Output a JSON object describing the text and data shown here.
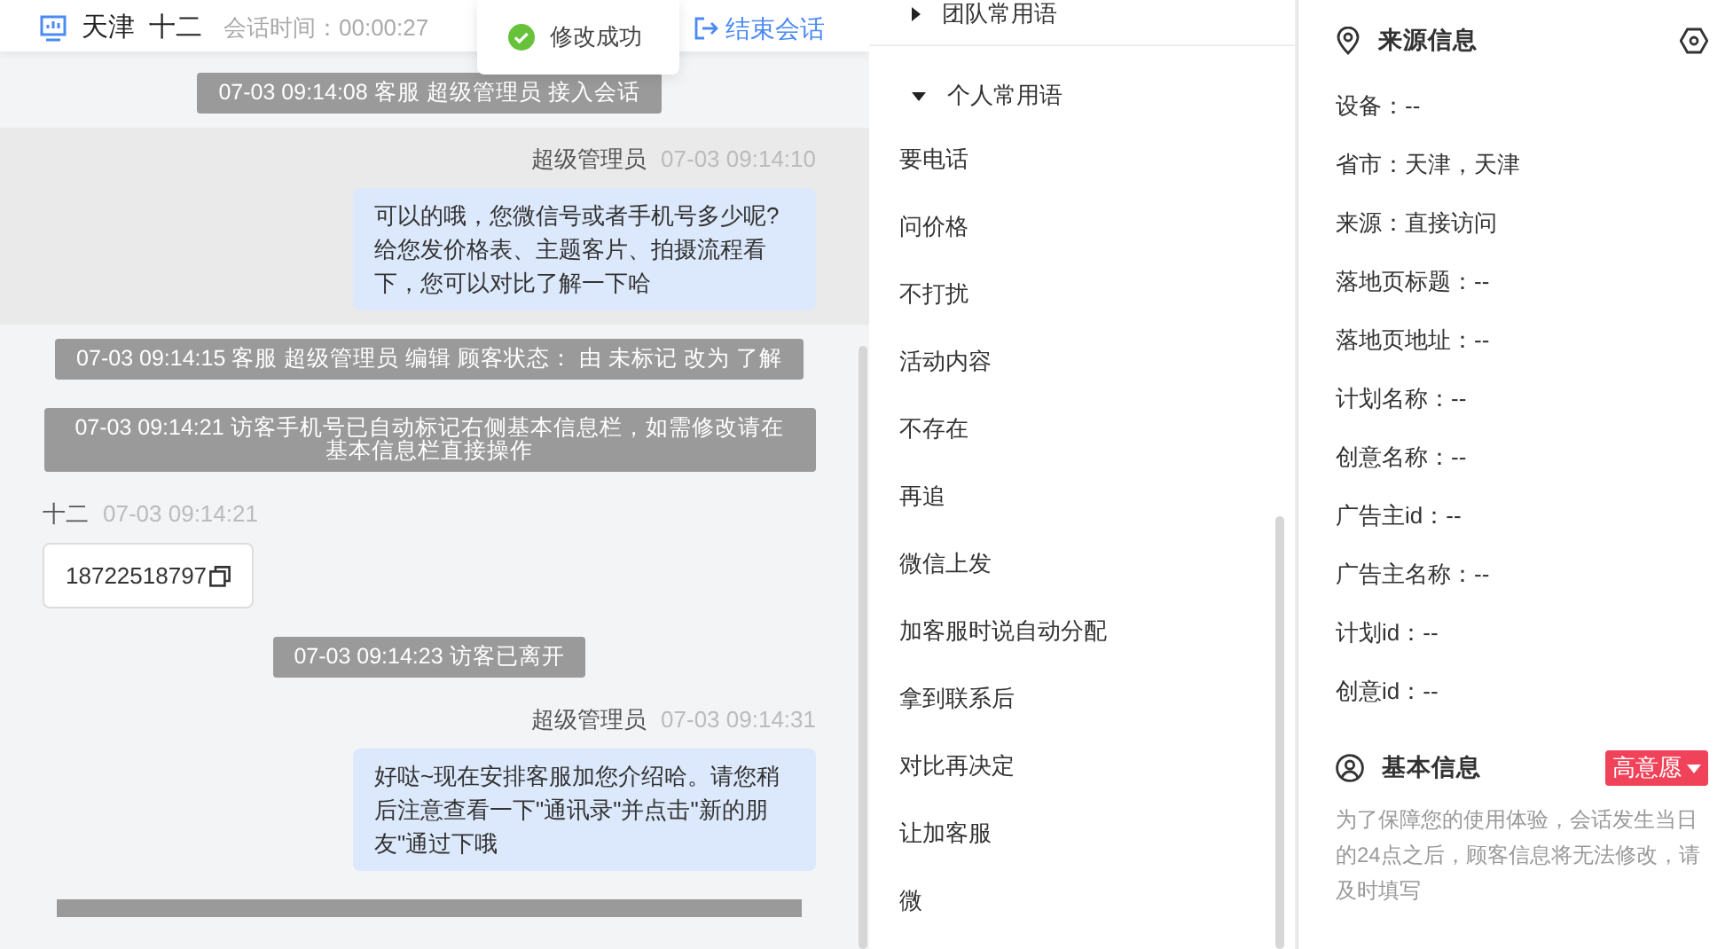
{
  "header": {
    "location": "天津",
    "visitor": "十二",
    "session_time": "会话时间：00:00:27",
    "end_button": "结束会话"
  },
  "toast": {
    "text": "修改成功"
  },
  "messages": [
    {
      "kind": "system",
      "text": "07-03 09:14:08 客服 超级管理员 接入会话"
    },
    {
      "kind": "agent",
      "sender": "超级管理员",
      "time": "07-03 09:14:10",
      "text": "可以的哦，您微信号或者手机号多少呢?给您发价格表、主题客片、拍摄流程看下，您可以对比了解一下哈",
      "highlighted": true
    },
    {
      "kind": "system",
      "text": "07-03 09:14:15 客服 超级管理员 编辑 顾客状态： 由 未标记 改为 了解"
    },
    {
      "kind": "system",
      "text": "07-03 09:14:21 访客手机号已自动标记右侧基本信息栏，如需修改请在基本信息栏直接操作"
    },
    {
      "kind": "visitor",
      "sender": "十二",
      "time": "07-03 09:14:21",
      "text": "18722518797"
    },
    {
      "kind": "system",
      "text": "07-03 09:14:23 访客已离开"
    },
    {
      "kind": "agent",
      "sender": "超级管理员",
      "time": "07-03 09:14:31",
      "text": "好哒~现在安排客服加您介绍哈。请您稍后注意查看一下\"通讯录\"并点击\"新的朋友\"通过下哦",
      "highlighted": false
    }
  ],
  "phrase_groups": [
    {
      "title": "团队常用语",
      "expanded": false
    },
    {
      "title": "个人常用语",
      "expanded": true,
      "items": [
        "要电话",
        "问价格",
        "不打扰",
        "活动内容",
        "不存在",
        "再追",
        "微信上发",
        "加客服时说自动分配",
        "拿到联系后",
        "对比再决定",
        "让加客服",
        "微"
      ]
    }
  ],
  "source_info": {
    "title": "来源信息",
    "fields": [
      "设备：--",
      "省市：天津，天津",
      "来源：直接访问",
      "落地页标题：--",
      "落地页地址：--",
      "计划名称：--",
      "创意名称：--",
      "广告主id：--",
      "广告主名称：--",
      "计划id：--",
      "创意id：--"
    ]
  },
  "basic_info": {
    "title": "基本信息",
    "tag": "高意愿",
    "notice": "为了保障您的使用体验，会话发生当日的24点之后，顾客信息将无法修改，请及时填写"
  }
}
